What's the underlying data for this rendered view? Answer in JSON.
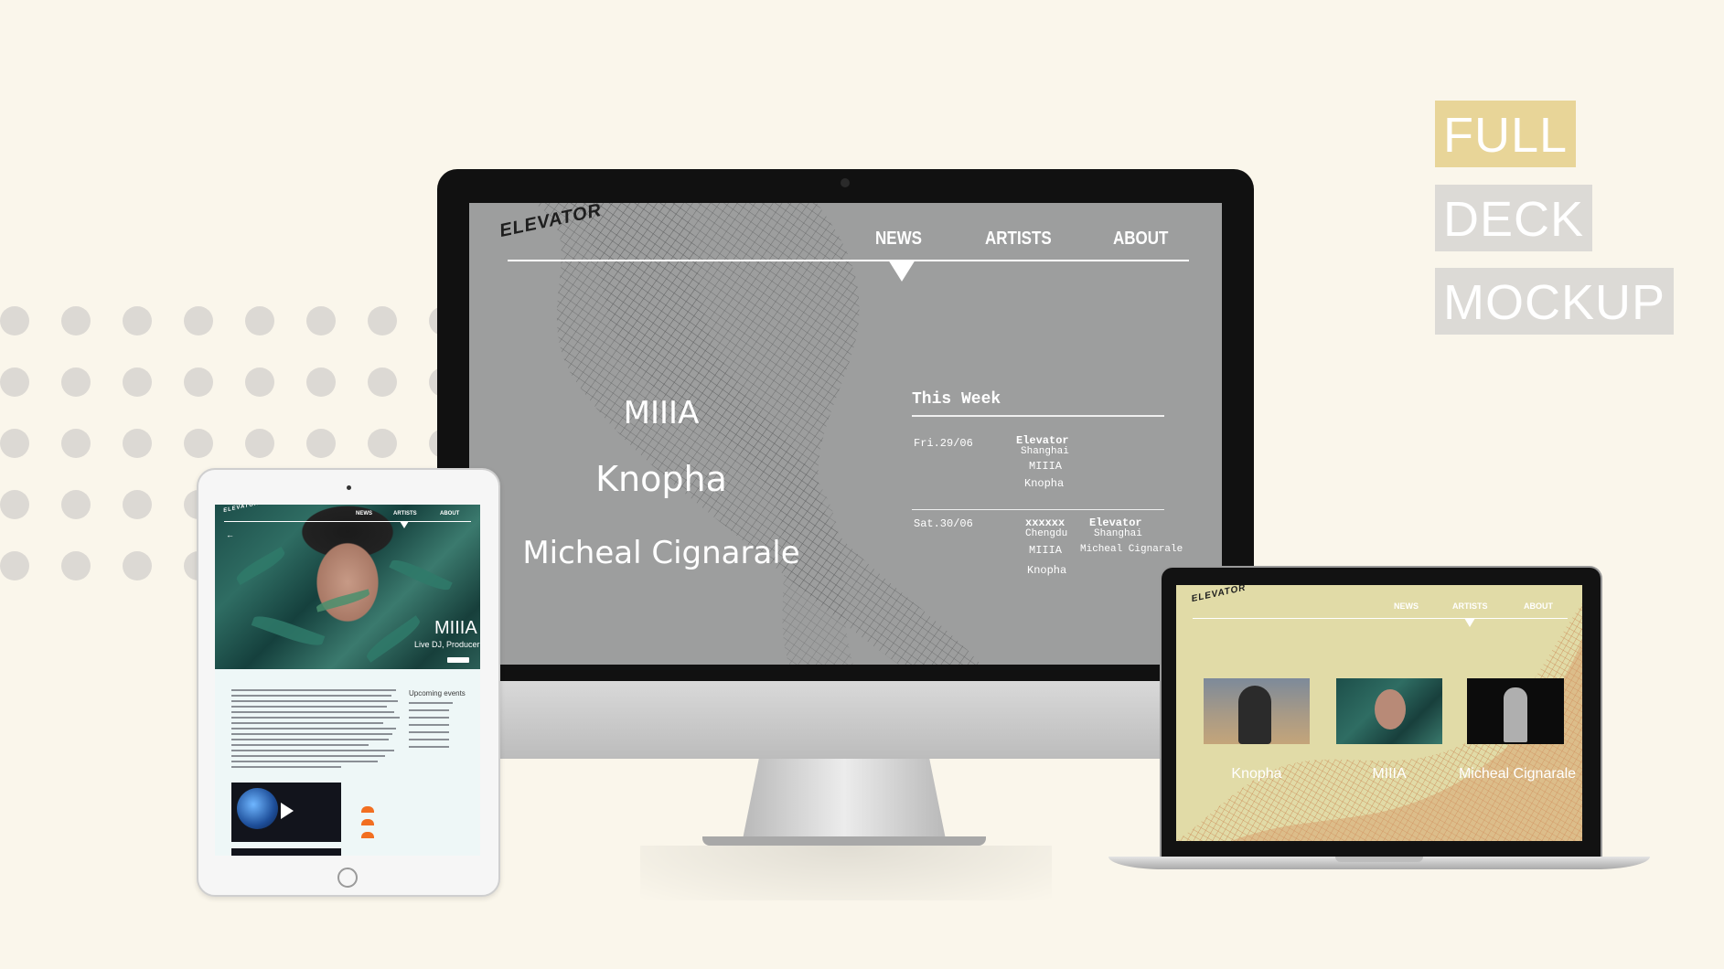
{
  "promo": {
    "line1": "FULL",
    "line2": "DECK",
    "line3": "MOCKUP"
  },
  "site": {
    "logo": "ELEVATOR",
    "nav": {
      "news": "NEWS",
      "artists": "ARTISTS",
      "about": "ABOUT"
    }
  },
  "desktop": {
    "active_nav": "NEWS",
    "artists": [
      "MIIIA",
      "Knopha",
      "Micheal Cignarale"
    ],
    "this_week": {
      "title": "This Week",
      "events": [
        {
          "date": "Fri.29/06",
          "venues": [
            {
              "name": "Elevator",
              "city": "Shanghai",
              "acts": [
                "MIIIA",
                "Knopha"
              ]
            }
          ]
        },
        {
          "date": "Sat.30/06",
          "venues": [
            {
              "name": "xxxxxx",
              "city": "Chengdu",
              "acts": [
                "MIIIA",
                "Knopha"
              ]
            },
            {
              "name": "Elevator",
              "city": "Shanghai",
              "acts": [
                "Micheal Cignarale"
              ]
            }
          ]
        }
      ]
    }
  },
  "tablet": {
    "active_nav": "ARTISTS",
    "artist_name": "MIIIA",
    "artist_role": "Live DJ, Producer",
    "upcoming_title": "Upcoming events"
  },
  "laptop": {
    "active_nav": "ARTISTS",
    "artists": [
      "Knopha",
      "MIIIA",
      "Micheal Cignarale"
    ]
  },
  "colors": {
    "background": "#faf6eb",
    "promo_accent": "#e8d598",
    "promo_muted": "#dcdad6",
    "desktop_screen": "#9d9e9e",
    "laptop_screen": "#e1dba7"
  }
}
